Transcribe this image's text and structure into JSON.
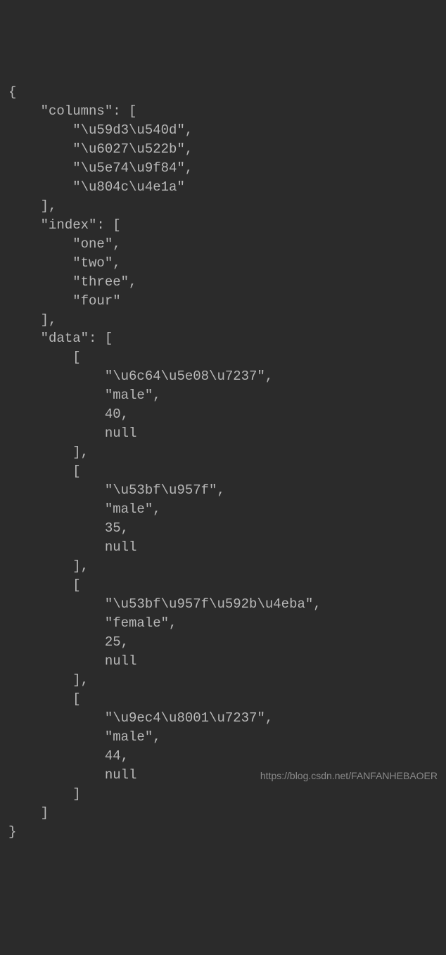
{
  "code_lines": [
    "{",
    "    \"columns\": [",
    "        \"\\u59d3\\u540d\",",
    "        \"\\u6027\\u522b\",",
    "        \"\\u5e74\\u9f84\",",
    "        \"\\u804c\\u4e1a\"",
    "    ],",
    "    \"index\": [",
    "        \"one\",",
    "        \"two\",",
    "        \"three\",",
    "        \"four\"",
    "    ],",
    "    \"data\": [",
    "        [",
    "            \"\\u6c64\\u5e08\\u7237\",",
    "            \"male\",",
    "            40,",
    "            null",
    "        ],",
    "        [",
    "            \"\\u53bf\\u957f\",",
    "            \"male\",",
    "            35,",
    "            null",
    "        ],",
    "        [",
    "            \"\\u53bf\\u957f\\u592b\\u4eba\",",
    "            \"female\",",
    "            25,",
    "            null",
    "        ],",
    "        [",
    "            \"\\u9ec4\\u8001\\u7237\",",
    "            \"male\",",
    "            44,",
    "            null",
    "        ]",
    "    ]",
    "}"
  ],
  "watermark": "https://blog.csdn.net/FANFANHEBAOER",
  "represented_json": {
    "columns": [
      "\\u59d3\\u540d",
      "\\u6027\\u522b",
      "\\u5e74\\u9f84",
      "\\u804c\\u4e1a"
    ],
    "index": [
      "one",
      "two",
      "three",
      "four"
    ],
    "data": [
      [
        "\\u6c64\\u5e08\\u7237",
        "male",
        40,
        null
      ],
      [
        "\\u53bf\\u957f",
        "male",
        35,
        null
      ],
      [
        "\\u53bf\\u957f\\u592b\\u4eba",
        "female",
        25,
        null
      ],
      [
        "\\u9ec4\\u8001\\u7237",
        "male",
        44,
        null
      ]
    ]
  }
}
